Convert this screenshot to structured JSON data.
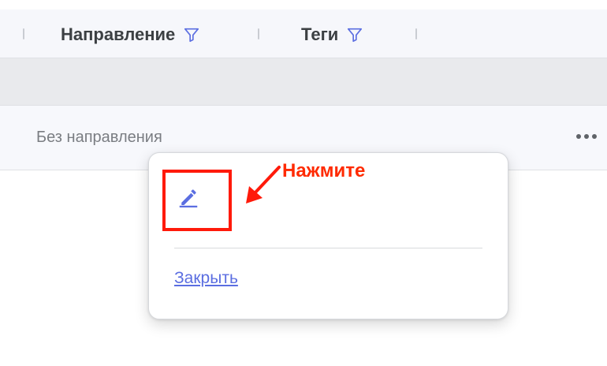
{
  "table": {
    "columns": [
      {
        "label": "Направление",
        "icon": "filter-icon"
      },
      {
        "label": "Теги",
        "icon": "filter-icon"
      }
    ],
    "rows": [
      {
        "direction": "Без направления",
        "actions_icon": "more-horizontal-icon"
      }
    ]
  },
  "popup": {
    "edit_icon": "pencil-icon",
    "close_label": "Закрыть"
  },
  "annotation": {
    "text": "Нажмите",
    "color": "#ff1a0a"
  },
  "colors": {
    "accent": "#5b6ee1",
    "header_bg": "#f6f7fb",
    "group_row_bg": "#e9eaed"
  }
}
